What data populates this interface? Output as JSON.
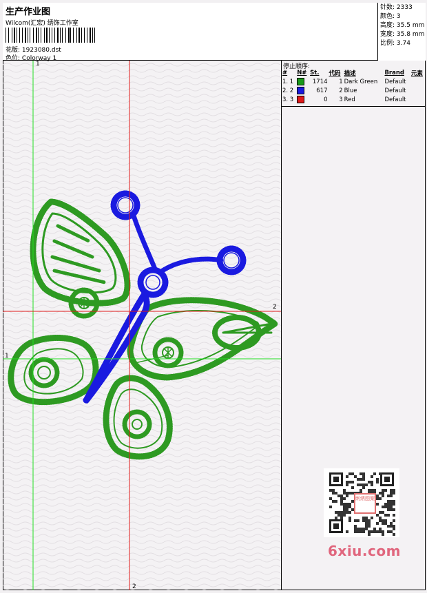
{
  "header": {
    "title": "生产作业图",
    "studio": "Wilcom(汇宏) 绣饰工作室",
    "design_label": "花版:",
    "design_file": "1923080.dst",
    "colorway_label": "色位:",
    "colorway": "Colorway 1"
  },
  "stats": {
    "stitches_label": "针数:",
    "stitches": "2333",
    "colors_label": "颜色:",
    "colors": "3",
    "height_label": "高度:",
    "height": "35.5 mm",
    "width_label": "宽度:",
    "width": "35.8 mm",
    "scale_label": "比例:",
    "scale": "3.74"
  },
  "stop_sequence": {
    "title": "停止顺序:",
    "headers": [
      "#",
      "N#",
      "St.",
      "代码",
      "描述",
      "Brand",
      "元素"
    ],
    "rows": [
      {
        "idx": "1. 1",
        "color": "#1a9a1a",
        "stitches": "1714",
        "code": "1",
        "desc": "Dark Green",
        "brand": "Default"
      },
      {
        "idx": "2. 2",
        "color": "#1a1ae0",
        "stitches": "617",
        "code": "2",
        "desc": "Blue",
        "brand": "Default"
      },
      {
        "idx": "3. 3",
        "color": "#e01a1a",
        "stitches": "0",
        "code": "3",
        "desc": "Red",
        "brand": "Default"
      }
    ]
  },
  "axes": {
    "top_green": "1",
    "left_green": "1",
    "right_red": "2",
    "bottom_red": "2"
  },
  "watermark": {
    "site": "6xiu.com",
    "seal": "刺绣图案"
  },
  "icons": {
    "qr": "qr-code-icon",
    "barcode": "barcode-icon"
  }
}
